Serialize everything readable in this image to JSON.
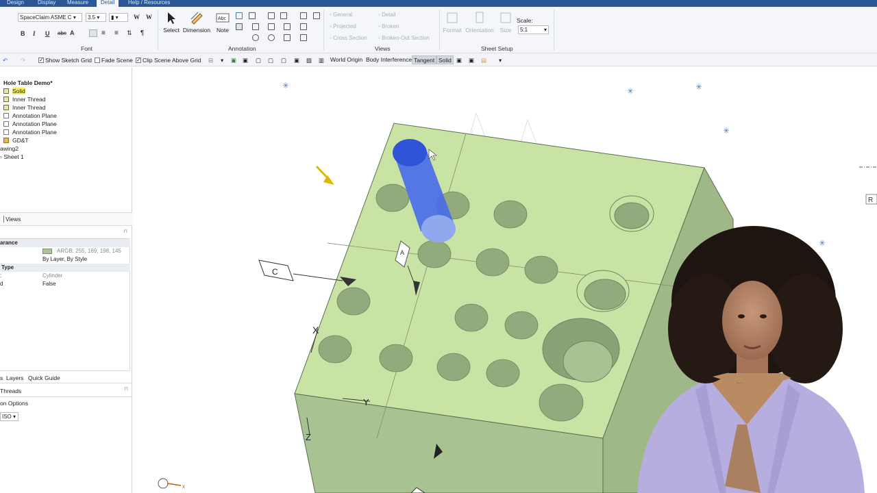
{
  "tabs": [
    "Design",
    "Display",
    "Measure",
    "Detail",
    "Help / Resources"
  ],
  "active_tab": "Detail",
  "font": {
    "family_value": "SpaceClaim ASME C",
    "size_value": "3.5",
    "group_label": "Font",
    "buttons": [
      "B",
      "I",
      "U",
      "abc",
      "A"
    ]
  },
  "annotation": {
    "select_label": "Select",
    "dimension_label": "Dimension",
    "note_label": "Note",
    "group_label": "Annotation"
  },
  "views": {
    "items": [
      "General",
      "Projected",
      "Cross Section",
      "Detail",
      "Broken",
      "Broken-Out Section"
    ],
    "group_label": "Views"
  },
  "sheet_setup": {
    "format_label": "Format",
    "orientation_label": "Orientation",
    "size_label": "Size",
    "scale_label": "Scale:",
    "scale_value": "5:1",
    "group_label": "Sheet Setup"
  },
  "toolbar2": {
    "show_sketch_grid": "Show Sketch Grid",
    "fade_scene": "Fade Scene",
    "clip_scene": "Clip Scene Above Grid",
    "world_origin": "World Origin",
    "body_interference": "Body Interference",
    "tangent": "Tangent",
    "solid": "Solid"
  },
  "tree": {
    "root": "Hole Table Demo*",
    "items": [
      "Solid",
      "Inner Thread",
      "Inner Thread",
      "Annotation Plane",
      "Annotation Plane",
      "Annotation Plane",
      "GD&T"
    ],
    "drawing": "awing2",
    "sheet": "Sheet 1"
  },
  "panels": {
    "views_tab": "Views",
    "appearance_header": "arance",
    "color_value": "ARGB: 255, 169, 198, 145",
    "color_mode": "By Layer, By Style",
    "type_header": "Type",
    "type_value": "Cylinder",
    "flag_value": "False",
    "bottom_tabs": [
      "s",
      "Layers",
      "Quick Guide"
    ],
    "threads_label": "Threads",
    "options_label": "on Options",
    "standard_value": "ISO"
  },
  "viewport": {
    "datum_c": "C",
    "datum_a": "A",
    "axis_x": "X",
    "axis_y": "Y",
    "axis_z": "Z",
    "triad_x": "x",
    "r_label": "R"
  },
  "colors": {
    "ribbon_blue": "#2b5797",
    "block_top": "#c9e3a5",
    "block_side": "#a9c291",
    "selected_cylinder": "#3a5fe0"
  }
}
